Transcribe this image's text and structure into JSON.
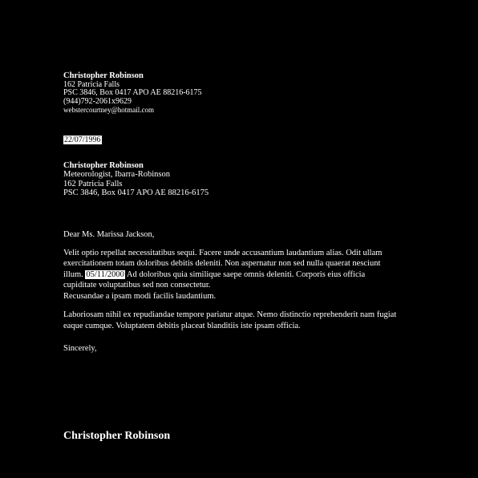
{
  "sender": {
    "name": "Christopher Robinson",
    "street": "162 Patricia Falls",
    "city": "PSC 3846, Box 0417 APO AE 88216-6175",
    "phone": "(944)792-2061x9629",
    "email": "webstercourtney@hotmail.com"
  },
  "date": "22/07/1996",
  "recipient": {
    "name": "Christopher Robinson",
    "title": "Meteorologist, Ibarra-Robinson",
    "street": "162 Patricia Falls",
    "city": "PSC 3846, Box 0417 APO AE 88216-6175"
  },
  "salutation": "Dear Ms. Marissa Jackson,",
  "body": {
    "para1_before": "Velit optio repellat necessitatibus sequi. Facere unde accusantium laudantium alias. Odit ullam exercitationem totam doloribus debitis deleniti. Non aspernatur non sed nulla quaerat nesciunt illum.",
    "para1_date": "05/11/2000",
    "para1_after": "Ad doloribus quia similique saepe omnis deleniti. Corporis eius officia cupiditate voluptatibus sed non consectetur.",
    "para2": "Recusandae a ipsam modi facilis laudantium.",
    "para3": "Laboriosam nihil ex repudiandae tempore pariatur atque. Nemo distinctio reprehenderit nam fugiat eaque cumque. Voluptatem debitis placeat blanditiis iste ipsam officia."
  },
  "closing": "Sincerely,",
  "signature": "Christopher Robinson"
}
